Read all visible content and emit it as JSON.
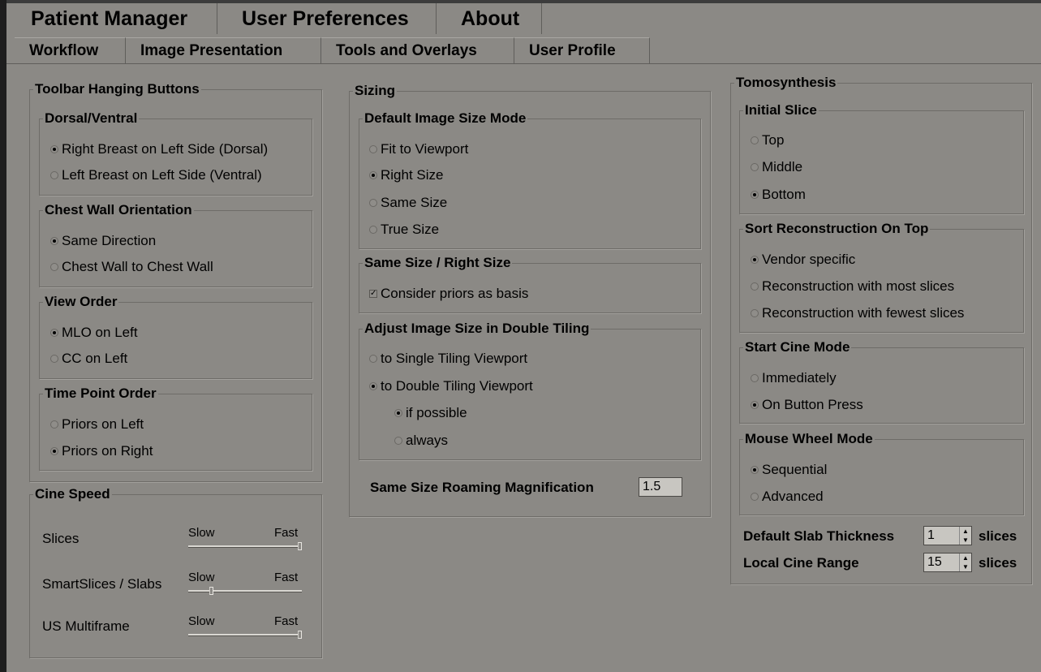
{
  "tabs_top": [
    "Patient Manager",
    "User Preferences",
    "About"
  ],
  "tabs_sub": [
    "Workflow",
    "Image Presentation",
    "Tools and Overlays",
    "User Profile"
  ],
  "toolbar": {
    "title": "Toolbar Hanging Buttons",
    "dorsal": {
      "title": "Dorsal/Ventral",
      "options": [
        "Right Breast on Left Side (Dorsal)",
        "Left Breast on Left Side (Ventral)"
      ],
      "selected": 0
    },
    "chest": {
      "title": "Chest Wall Orientation",
      "options": [
        "Same Direction",
        "Chest Wall to Chest Wall"
      ],
      "selected": 0
    },
    "view": {
      "title": "View Order",
      "options": [
        "MLO on Left",
        "CC on Left"
      ],
      "selected": 0
    },
    "time": {
      "title": "Time Point Order",
      "options": [
        "Priors on Left",
        "Priors on Right"
      ],
      "selected": 1
    }
  },
  "cine": {
    "title": "Cine Speed",
    "slow": "Slow",
    "fast": "Fast",
    "rows": [
      {
        "label": "Slices",
        "level": 1.0
      },
      {
        "label": "SmartSlices / Slabs",
        "level": 0.2
      },
      {
        "label": "US Multiframe",
        "level": 1.0
      }
    ]
  },
  "sizing": {
    "title": "Sizing",
    "mode": {
      "title": "Default Image Size Mode",
      "options": [
        "Fit to Viewport",
        "Right Size",
        "Same Size",
        "True Size"
      ],
      "selected": 1
    },
    "same": {
      "title": "Same Size / Right Size",
      "checkbox": "Consider priors as basis",
      "checked": true
    },
    "adjust": {
      "title": "Adjust Image Size in Double Tiling",
      "options": [
        "to Single Tiling Viewport",
        "to Double Tiling Viewport"
      ],
      "selected": 1,
      "suboptions": [
        "if possible",
        "always"
      ],
      "subselected": 0
    },
    "roaming_label": "Same Size Roaming Magnification",
    "roaming_value": "1.5"
  },
  "tomo": {
    "title": "Tomosynthesis",
    "initial": {
      "title": "Initial Slice",
      "options": [
        "Top",
        "Middle",
        "Bottom"
      ],
      "selected": 2
    },
    "sort": {
      "title": "Sort Reconstruction On Top",
      "options": [
        "Vendor specific",
        "Reconstruction with most slices",
        "Reconstruction with fewest slices"
      ],
      "selected": 0
    },
    "start": {
      "title": "Start Cine Mode",
      "options": [
        "Immediately",
        "On Button Press"
      ],
      "selected": 1
    },
    "wheel": {
      "title": "Mouse Wheel Mode",
      "options": [
        "Sequential",
        "Advanced"
      ],
      "selected": 0
    },
    "slab_label": "Default Slab Thickness",
    "slab_value": "1",
    "range_label": "Local Cine Range",
    "range_value": "15",
    "unit": "slices"
  }
}
